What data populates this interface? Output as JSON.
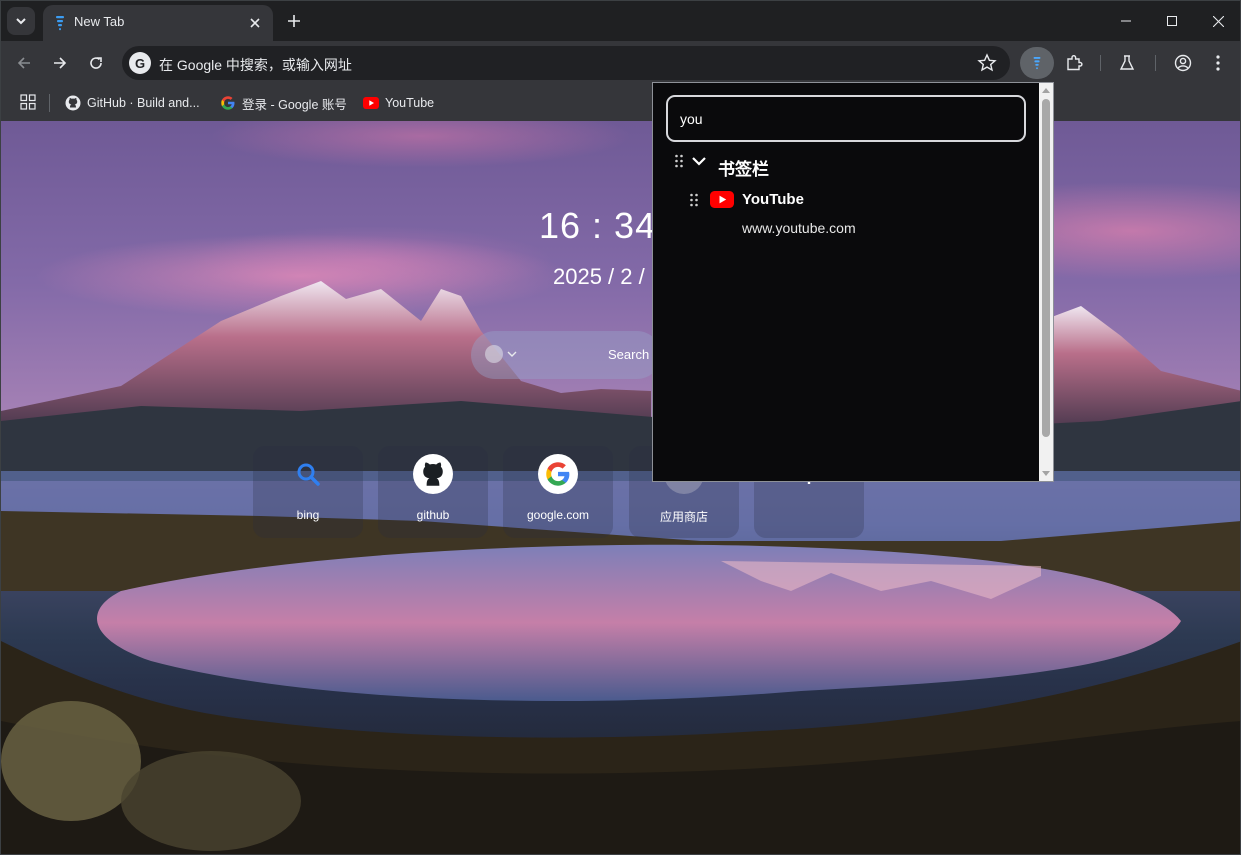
{
  "browser": {
    "tab": {
      "title": "New Tab",
      "favicon": "bookmark-ext-icon"
    },
    "omnibox": {
      "text": "在 Google 中搜索，或输入网址",
      "badge": "G"
    },
    "bookmarks_bar": [
      {
        "label": "GitHub · Build and...",
        "icon": "github-icon"
      },
      {
        "label": "登录 - Google 账号",
        "icon": "google-icon"
      },
      {
        "label": "YouTube",
        "icon": "youtube-icon"
      }
    ]
  },
  "ntp": {
    "clock": "16 : 34 :",
    "date": "2025 / 2 /",
    "search_placeholder": "Search",
    "shortcuts": [
      {
        "label": "bing",
        "icon": "bing-search-icon"
      },
      {
        "label": "github",
        "icon": "github-icon"
      },
      {
        "label": "google.com",
        "icon": "google-icon"
      },
      {
        "label": "应用商店",
        "icon": "app-store-icon"
      },
      {
        "label": "",
        "icon": "plus-icon"
      }
    ]
  },
  "popup": {
    "search_value": "you",
    "folder": {
      "label": "书签栏",
      "expanded": true
    },
    "results": [
      {
        "title": "YouTube",
        "url": "www.youtube.com",
        "icon": "youtube-icon"
      }
    ]
  },
  "colors": {
    "chrome_dark": "#202124",
    "toolbar": "#35363a",
    "youtube_red": "#ff0000",
    "popup_bg": "#0a0a0c"
  }
}
